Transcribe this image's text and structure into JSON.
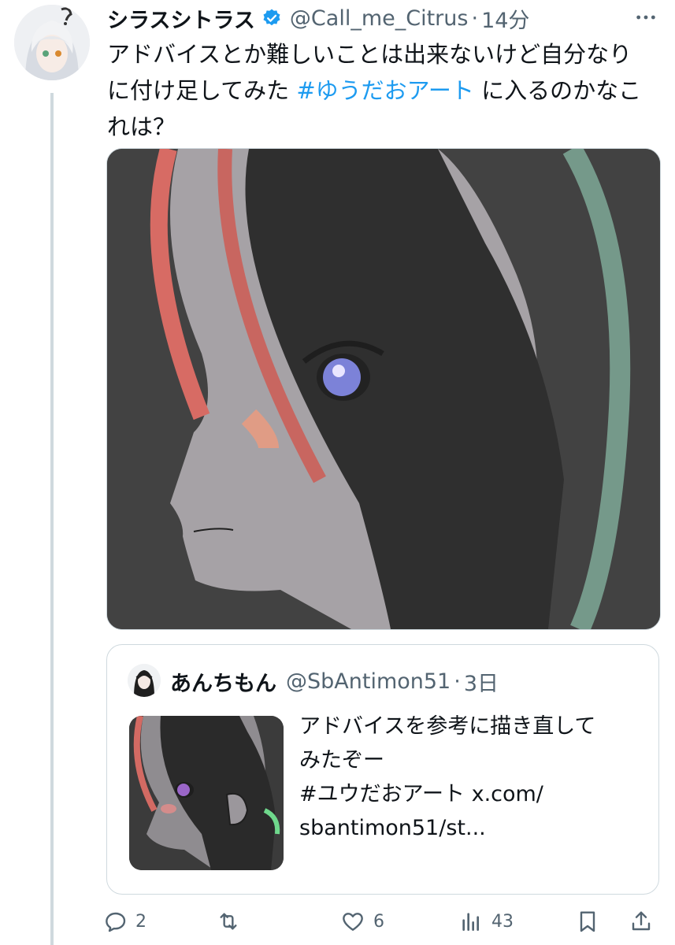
{
  "tweet": {
    "display_name": "シラスシトラス",
    "handle": "@Call_me_Citrus",
    "separator": "·",
    "time": "14分",
    "text_part1": "アドバイスとか難しいことは出来ないけど自分なりに付け足してみた ",
    "hashtag": "#ゆうだおアート",
    "text_part2": " に入るのかなこれは？"
  },
  "quote": {
    "display_name": "あんちもん",
    "handle": "@SbAntimon51",
    "separator": "·",
    "time": "3日",
    "text": "アドバイスを参考に描き直して\nみたぞー\n#ユウだおアート x.com/\nsbantimon51/st..."
  },
  "actions": {
    "reply_count": "2",
    "like_count": "6",
    "views_count": "43"
  },
  "colors": {
    "link": "#1d9bf0",
    "secondary_text": "#536471",
    "border": "#cfd9de",
    "verified": "#1d9bf0"
  },
  "icons": [
    "more-icon",
    "verified-badge-icon",
    "reply-icon",
    "retweet-icon",
    "like-icon",
    "views-icon",
    "bookmark-icon",
    "share-icon"
  ]
}
